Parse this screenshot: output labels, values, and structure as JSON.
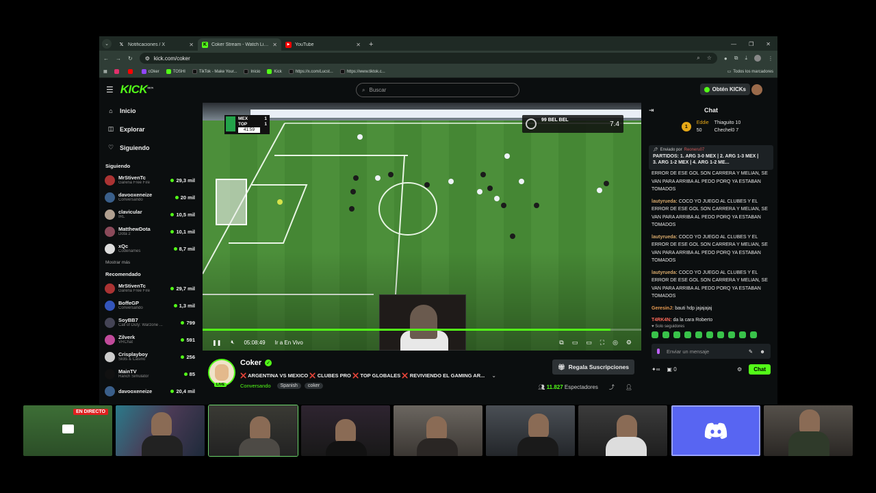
{
  "browser": {
    "tabs": [
      {
        "title": "Notificaciones / X",
        "icon": "x-icon",
        "active": false
      },
      {
        "title": "Coker Stream - Watch Live on K",
        "icon": "kick-icon",
        "active": true
      },
      {
        "title": "YouTube",
        "icon": "youtube-icon",
        "active": false
      }
    ],
    "url": "kick.com/coker",
    "bookmarks": [
      {
        "label": "",
        "color": "#e1306c"
      },
      {
        "label": "",
        "color": "#ff0000"
      },
      {
        "label": "cOker",
        "color": "#9146ff"
      },
      {
        "label": "TOSHI",
        "color": "#53fc18"
      },
      {
        "label": "TikTok - Make Your...",
        "color": "#111111"
      },
      {
        "label": "Inicio",
        "color": "#111111"
      },
      {
        "label": "Kick",
        "color": "#53fc18"
      },
      {
        "label": "https://x.com/Lucst...",
        "color": "#111111"
      },
      {
        "label": "https://www.tiktok.c...",
        "color": "#111111"
      }
    ],
    "all_bookmarks": "Todos los marcadores"
  },
  "topnav": {
    "logo": "KICK",
    "logo_sup": "BETA",
    "search_placeholder": "Buscar",
    "kicks_button": "Obtén KICKs"
  },
  "sidebar": {
    "nav": [
      {
        "label": "Inicio",
        "icon": "home-icon"
      },
      {
        "label": "Explorar",
        "icon": "compass-icon"
      },
      {
        "label": "Siguiendo",
        "icon": "heart-icon"
      }
    ],
    "following_title": "Siguiendo",
    "following": [
      {
        "name": "MrStivenTc",
        "category": "Garena Free Fire",
        "viewers": "29,3 mil",
        "color": "#a33"
      },
      {
        "name": "davooxeneize",
        "category": "Conversando",
        "viewers": "20 mil",
        "color": "#3a5f8a"
      },
      {
        "name": "clavicular",
        "category": "IRL",
        "viewers": "10,5 mil",
        "color": "#b0a090"
      },
      {
        "name": "MatthewDota",
        "category": "Dota 2",
        "viewers": "10,1 mil",
        "color": "#8a4a5a"
      },
      {
        "name": "xQc",
        "category": "Codenames",
        "viewers": "8,7 mil",
        "color": "#ddd"
      }
    ],
    "show_more": "Mostrar más",
    "recommended_title": "Recomendado",
    "recommended": [
      {
        "name": "MrStivenTc",
        "category": "Garena Free Fire",
        "viewers": "29,7 mil",
        "color": "#a33"
      },
      {
        "name": "BoffeGP",
        "category": "Conversando",
        "viewers": "1,3 mil",
        "color": "#3355bb"
      },
      {
        "name": "SoyBB7",
        "category": "Call of Duty: Warzone ...",
        "viewers": "799",
        "color": "#445"
      },
      {
        "name": "Zilverk",
        "category": "VRChat",
        "viewers": "591",
        "color": "#c04a9a"
      },
      {
        "name": "Crisplayboy",
        "category": "Slots & Casino",
        "viewers": "256",
        "color": "#ccc"
      },
      {
        "name": "MainTV",
        "category": "Ranch Simulator",
        "viewers": "85",
        "color": "#111"
      },
      {
        "name": "davooxeneize",
        "category": "",
        "viewers": "20,4 mil",
        "color": "#3a5f8a"
      }
    ]
  },
  "video": {
    "score_home": "MEX",
    "score_home_goals": "1",
    "score_away": "TOP",
    "score_away_goals": "1",
    "match_clock": "41:59",
    "player_card": "99 BEL BEL",
    "player_rating": "7.4",
    "time": "05:08:49",
    "go_live": "Ir a En Vivo",
    "progress": 0.93
  },
  "channel": {
    "name": "Coker",
    "live_label": "LIVE",
    "title": "❌ ARGENTINA VS MEXICO ❌ CLUBES PRO ❌ TOP GLOBALES ❌ REVIVIENDO EL GAMING AR...",
    "category": "Conversando",
    "tags": [
      "Spanish",
      "coker"
    ],
    "gift_button": "Regala Suscripciones",
    "viewers": "11.827",
    "viewers_label": "Espectadores"
  },
  "chat": {
    "title": "Chat",
    "leaders": [
      {
        "rank": "1",
        "name": "Eddie",
        "count": "50"
      },
      {
        "name": "Thiaguito",
        "count": "10"
      },
      {
        "name": "Chechel0",
        "count": "7"
      }
    ],
    "pinned_by_label": "Enviado por",
    "pinned_by_user": "Reoneru07",
    "pinned_text": "PARTIDOS: 1. ARG 3-0 MEX | 2. ARG 1-3 MEX | 3. ARG 1-2 MEX | 4. ARG 1-2 ME...",
    "messages": [
      {
        "user": "",
        "text": "ERROR DE ESE GOL SON CARRERA Y MELIAN, SE VAN PARA ARRIBA AL PEDO PORQ YA ESTABAN TOMADOS",
        "cls": "u1"
      },
      {
        "user": "lautyrueda:",
        "text": "COCO YO JUEGO AL CLUBES Y EL ERROR DE ESE GOL SON CARRERA Y MELIAN, SE VAN PARA ARRIBA AL PEDO PORQ YA ESTABAN TOMADOS",
        "cls": "u1"
      },
      {
        "user": "lautyrueda:",
        "text": "COCO YO JUEGO AL CLUBES Y EL ERROR DE ESE GOL SON CARRERA Y MELIAN, SE VAN PARA ARRIBA AL PEDO PORQ YA ESTABAN TOMADOS",
        "cls": "u1"
      },
      {
        "user": "lautyrueda:",
        "text": "COCO YO JUEGO AL CLUBES Y EL ERROR DE ESE GOL SON CARRERA Y MELIAN, SE VAN PARA ARRIBA AL PEDO PORQ YA ESTABAN TOMADOS",
        "cls": "u1"
      },
      {
        "user": "GeresinJ:",
        "text": "bauti hdp jajajajaj",
        "cls": "u2"
      },
      {
        "user": "T4RK4N:",
        "text": "da la cara Roberto",
        "cls": "u3"
      }
    ],
    "followers_only": "Solo seguidores",
    "input_placeholder": "Enviar un mensaje",
    "kicks_count": "0",
    "send_button": "Chat"
  },
  "strip": {
    "live_tag": "EN DIRECTO"
  }
}
